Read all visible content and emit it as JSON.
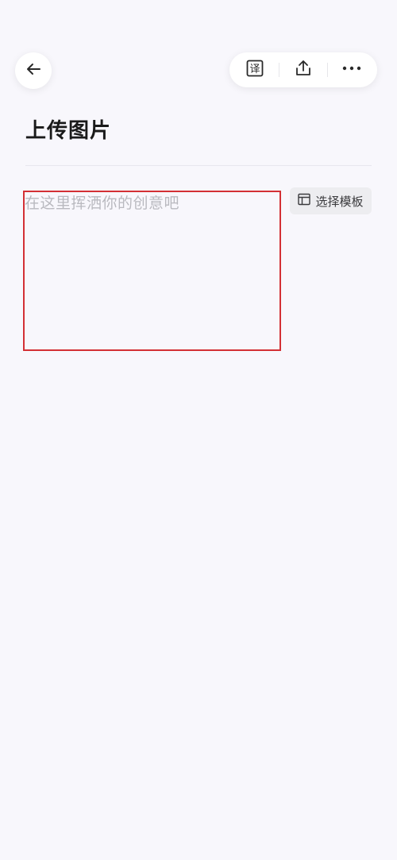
{
  "header": {
    "back_icon": "arrow-left-icon",
    "toolbar": [
      {
        "icon": "translate-icon",
        "glyph": "译"
      },
      {
        "icon": "share-upload-icon"
      },
      {
        "icon": "more-dots-icon"
      }
    ]
  },
  "page": {
    "title": "上传图片"
  },
  "editor": {
    "placeholder": "在这里挥洒你的创意吧"
  },
  "template_button": {
    "icon": "layout-template-icon",
    "label": "选择模板"
  },
  "colors": {
    "background": "#f8f7fc",
    "highlight_border": "#d33035",
    "placeholder": "#b9b9bf"
  }
}
